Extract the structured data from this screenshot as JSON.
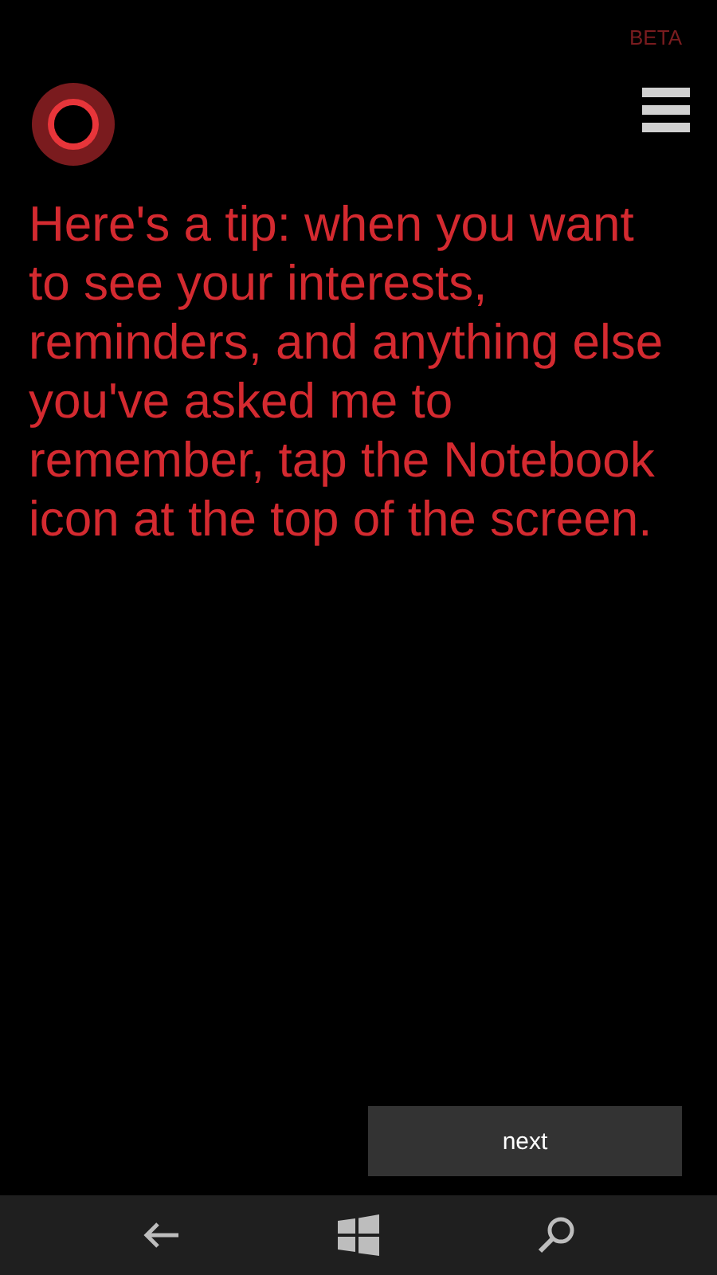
{
  "badge": "BETA",
  "tip": "Here's a tip: when you want to see your interests, reminders, and anything else you've asked me to remember, tap the Notebook icon at the top of the screen.",
  "next_button": "next"
}
